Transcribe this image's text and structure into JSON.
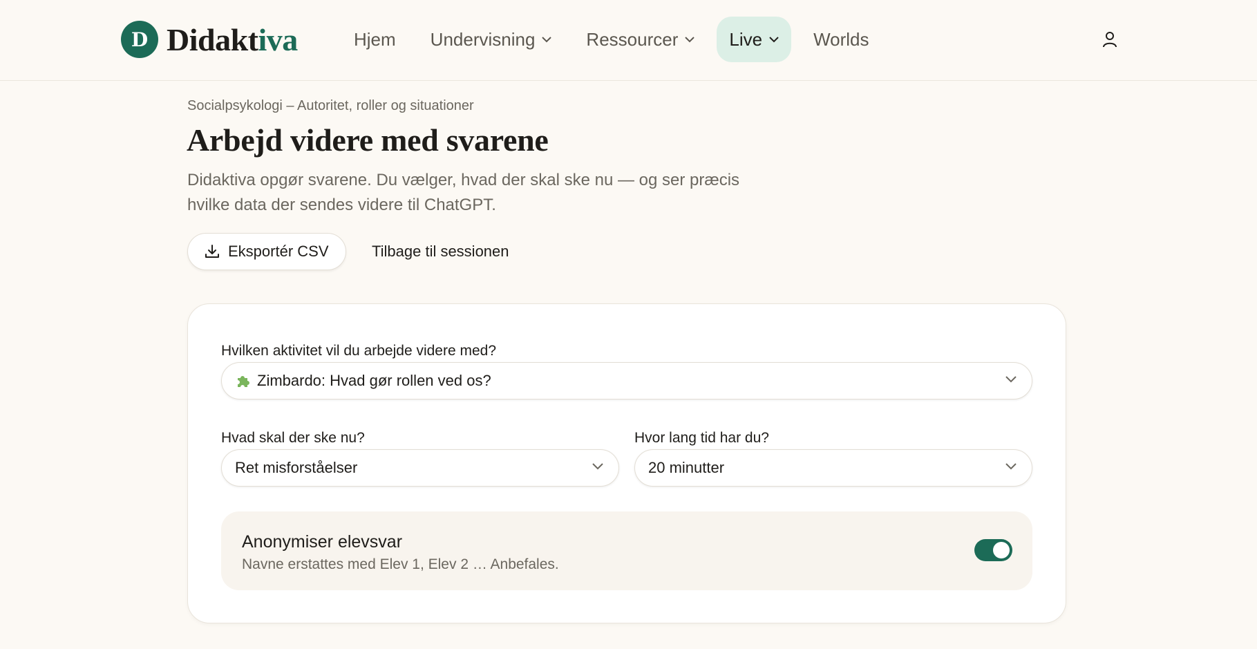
{
  "app": {
    "logo_letter": "D",
    "logo_text_main": "Didakt",
    "logo_text_accent": "iva"
  },
  "nav": {
    "items": [
      {
        "label": "Hjem",
        "dropdown": false,
        "active": false
      },
      {
        "label": "Undervisning",
        "dropdown": true,
        "active": false
      },
      {
        "label": "Ressourcer",
        "dropdown": true,
        "active": false
      },
      {
        "label": "Live",
        "dropdown": true,
        "active": true
      },
      {
        "label": "Worlds",
        "dropdown": false,
        "active": false
      }
    ],
    "user_icon": "user-icon"
  },
  "header": {
    "eyebrow": "Socialpsykologi – Autoritet, roller og situationer",
    "title": "Arbejd videre med svarene",
    "subtitle": "Didaktiva opgør svarene. Du vælger, hvad der skal ske nu — og ser præcis hvilke data der sendes videre til ChatGPT."
  },
  "actions": {
    "export_label": "Eksportér CSV",
    "back_label": "Tilbage til sessionen"
  },
  "form": {
    "activity": {
      "label": "Hvilken aktivitet vil du arbejde videre med?",
      "value": "Zimbardo: Hvad gør rollen ved os?",
      "icon": "puzzle-icon"
    },
    "next_step": {
      "label": "Hvad skal der ske nu?",
      "value": "Ret misforståelser"
    },
    "duration": {
      "label": "Hvor lang tid har du?",
      "value": "20 minutter"
    },
    "anonymize": {
      "title": "Anonymiser elevsvar",
      "description": "Navne erstattes med Elev 1, Elev 2 … Anbefales.",
      "enabled": true
    }
  },
  "colors": {
    "accent": "#1c6b57",
    "active_nav_bg": "#dcefe6",
    "page_bg": "#fcf9f4"
  }
}
